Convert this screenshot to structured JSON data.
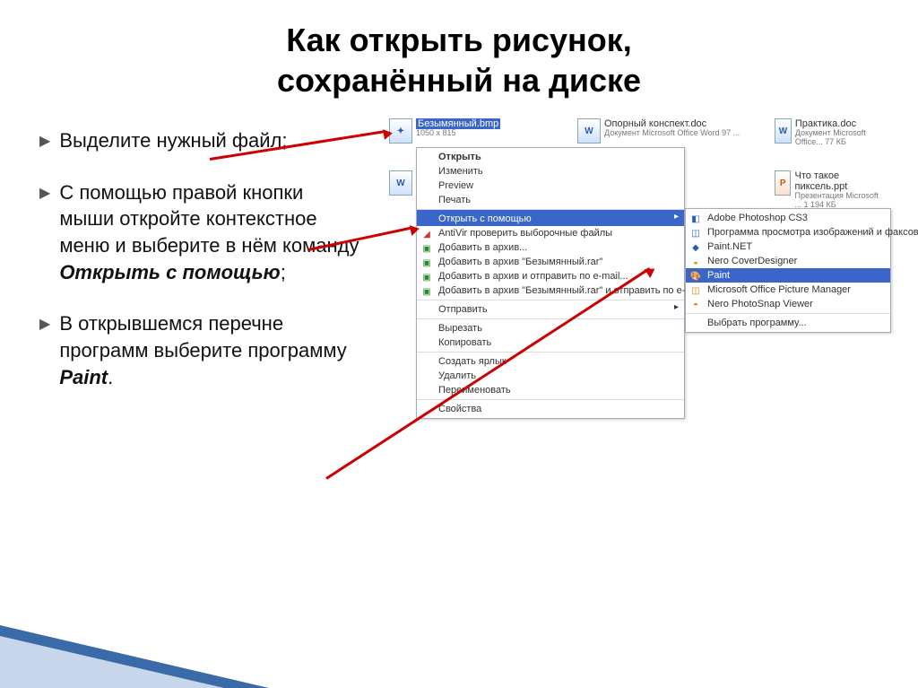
{
  "title_l1": "Как открыть рисунок,",
  "title_l2": "сохранённый на диске",
  "bullets": {
    "b1": "Выделите нужный файл;",
    "b2_a": "С помощью правой кнопки мыши откройте контекстное меню и выберите в нём команду ",
    "b2_b": "Открыть с помощью",
    "b2_c": ";",
    "b3_a": "В открывшемся перечне программ выберите программу ",
    "b3_b": "Paint",
    "b3_c": "."
  },
  "files": {
    "f1_name": "Безымянный.bmp",
    "f1_sub": "1050 x 815",
    "f2_name": "Опорный конспект.doc",
    "f2_sub": "Документ Microsoft Office Word 97 ...",
    "f3_name": "Практика.doc",
    "f3_sub": "Документ Microsoft Office... 77 КБ",
    "f4_name": "Что такое пиксель.ppt",
    "f4_sub": "Презентация Microsoft ... 1 194 КБ"
  },
  "menu1": {
    "open": "Открыть",
    "edit": "Изменить",
    "preview": "Preview",
    "print": "Печать",
    "open_with": "Открыть с помощью",
    "antivir": "AntiVir проверить выборочные файлы",
    "add_arch": "Добавить в архив...",
    "add_arch_bez": "Добавить в архив \"Безымянный.rar\"",
    "add_send": "Добавить в архив и отправить по e-mail...",
    "add_send_bez": "Добавить в архив \"Безымянный.rar\" и отправить по e-mail",
    "send": "Отправить",
    "cut": "Вырезать",
    "copy": "Копировать",
    "shortcut": "Создать ярлык",
    "delete": "Удалить",
    "rename": "Переименовать",
    "props": "Свойства"
  },
  "menu2": {
    "ps": "Adobe Photoshop CS3",
    "viewer": "Программа просмотра изображений и факсов",
    "paintnet": "Paint.NET",
    "nero_cd": "Nero CoverDesigner",
    "paint": "Paint",
    "mspic": "Microsoft Office Picture Manager",
    "nerops": "Nero PhotoSnap Viewer",
    "choose": "Выбрать программу..."
  }
}
